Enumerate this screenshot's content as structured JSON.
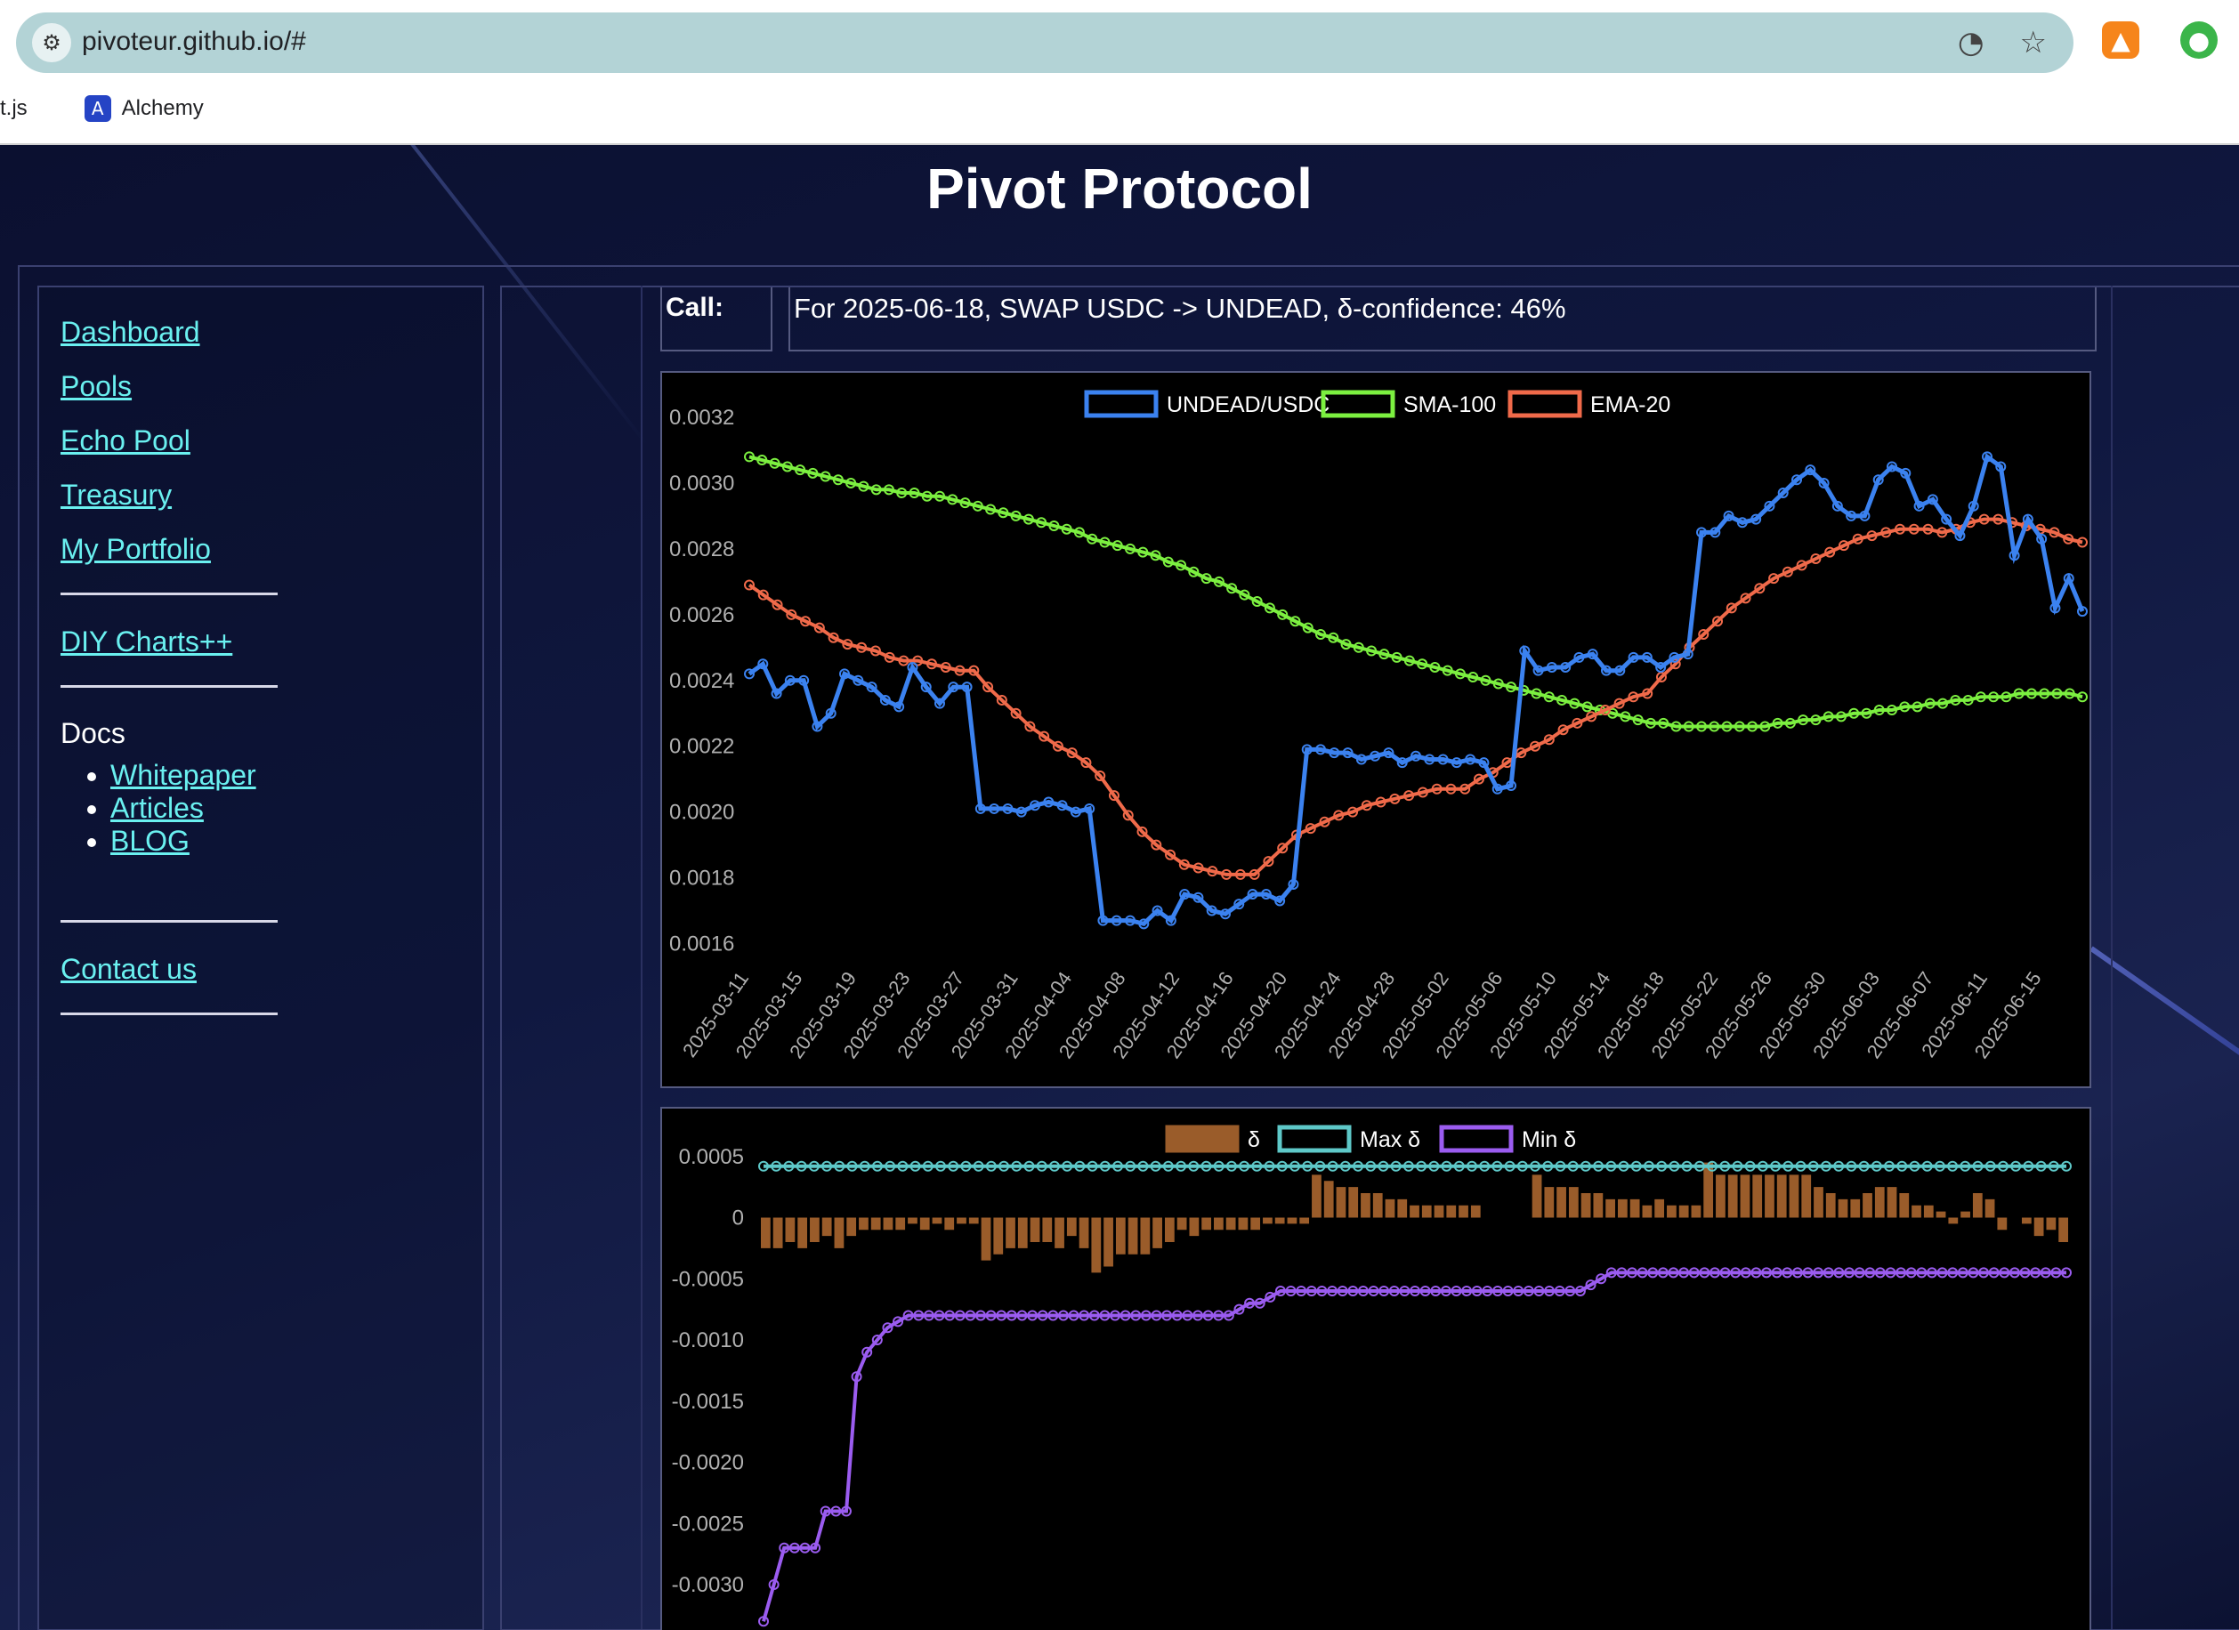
{
  "browser": {
    "url": "pivoteur.github.io/#",
    "bookmarks": [
      {
        "label": "t.js"
      },
      {
        "label": "Alchemy"
      }
    ]
  },
  "page": {
    "title": "Pivot Protocol"
  },
  "sidebar": {
    "nav": [
      "Dashboard",
      "Pools",
      "Echo Pool",
      "Treasury",
      "My Portfolio"
    ],
    "diy": "DIY Charts++",
    "docs_label": "Docs",
    "docs": [
      "Whitepaper",
      "Articles",
      "BLOG"
    ],
    "contact": "Contact us"
  },
  "call": {
    "label": "Call:",
    "text": "For 2025-06-18, SWAP USDC -> UNDEAD, δ-confidence: 46%"
  },
  "colors": {
    "price": "#3b82f0",
    "sma": "#7cf040",
    "ema": "#f06a4a",
    "delta": "#9a5c2a",
    "max_delta": "#5ec8c8",
    "min_delta": "#9b5cf0",
    "link": "#6af0f0"
  },
  "chart_data": [
    {
      "type": "line",
      "series": [
        {
          "name": "UNDEAD/USDC",
          "values": [
            0.00242,
            0.00245,
            0.00236,
            0.0024,
            0.0024,
            0.00226,
            0.0023,
            0.00242,
            0.0024,
            0.00238,
            0.00234,
            0.00232,
            0.00244,
            0.00238,
            0.00233,
            0.00238,
            0.00238,
            0.00201,
            0.00201,
            0.00201,
            0.002,
            0.00202,
            0.00203,
            0.00202,
            0.002,
            0.00201,
            0.00167,
            0.00167,
            0.00167,
            0.00166,
            0.0017,
            0.00167,
            0.00175,
            0.00174,
            0.0017,
            0.00169,
            0.00172,
            0.00175,
            0.00175,
            0.00173,
            0.00178,
            0.00219,
            0.00219,
            0.00218,
            0.00218,
            0.00216,
            0.00217,
            0.00218,
            0.00215,
            0.00217,
            0.00216,
            0.00216,
            0.00215,
            0.00216,
            0.00215,
            0.00207,
            0.00208,
            0.00249,
            0.00243,
            0.00244,
            0.00244,
            0.00247,
            0.00248,
            0.00243,
            0.00243,
            0.00247,
            0.00247,
            0.00244,
            0.00247,
            0.00248,
            0.00285,
            0.00285,
            0.0029,
            0.00288,
            0.00289,
            0.00293,
            0.00297,
            0.00301,
            0.00304,
            0.003,
            0.00293,
            0.0029,
            0.0029,
            0.00301,
            0.00305,
            0.00303,
            0.00293,
            0.00295,
            0.00289,
            0.00284,
            0.00293,
            0.00308,
            0.00305,
            0.00278,
            0.00289,
            0.00283,
            0.00262,
            0.00271,
            0.00261
          ],
          "markers": true
        },
        {
          "name": "SMA-100",
          "values": [
            0.00308,
            0.00307,
            0.00306,
            0.00305,
            0.00304,
            0.00303,
            0.00302,
            0.00301,
            0.003,
            0.00299,
            0.00298,
            0.00298,
            0.00297,
            0.00297,
            0.00296,
            0.00296,
            0.00295,
            0.00294,
            0.00293,
            0.00292,
            0.00291,
            0.0029,
            0.00289,
            0.00288,
            0.00287,
            0.00286,
            0.00285,
            0.00283,
            0.00282,
            0.00281,
            0.0028,
            0.00279,
            0.00278,
            0.00276,
            0.00275,
            0.00273,
            0.00271,
            0.0027,
            0.00268,
            0.00266,
            0.00264,
            0.00262,
            0.0026,
            0.00258,
            0.00256,
            0.00254,
            0.00253,
            0.00251,
            0.0025,
            0.00249,
            0.00248,
            0.00247,
            0.00246,
            0.00245,
            0.00244,
            0.00243,
            0.00242,
            0.00241,
            0.0024,
            0.00239,
            0.00238,
            0.00237,
            0.00236,
            0.00235,
            0.00234,
            0.00233,
            0.00232,
            0.00231,
            0.0023,
            0.00229,
            0.00228,
            0.00227,
            0.00227,
            0.00226,
            0.00226,
            0.00226,
            0.00226,
            0.00226,
            0.00226,
            0.00226,
            0.00226,
            0.00227,
            0.00227,
            0.00228,
            0.00228,
            0.00229,
            0.00229,
            0.0023,
            0.0023,
            0.00231,
            0.00231,
            0.00232,
            0.00232,
            0.00233,
            0.00233,
            0.00234,
            0.00234,
            0.00235,
            0.00235,
            0.00235,
            0.00236,
            0.00236,
            0.00236,
            0.00236,
            0.00236,
            0.00235
          ],
          "markers": true
        },
        {
          "name": "EMA-20",
          "values": [
            0.00269,
            0.00266,
            0.00263,
            0.0026,
            0.00258,
            0.00256,
            0.00253,
            0.00251,
            0.0025,
            0.00249,
            0.00247,
            0.00246,
            0.00246,
            0.00245,
            0.00244,
            0.00243,
            0.00243,
            0.00238,
            0.00234,
            0.0023,
            0.00226,
            0.00223,
            0.0022,
            0.00218,
            0.00215,
            0.00211,
            0.00205,
            0.00199,
            0.00194,
            0.0019,
            0.00187,
            0.00184,
            0.00183,
            0.00182,
            0.00181,
            0.00181,
            0.00181,
            0.00185,
            0.00189,
            0.00193,
            0.00195,
            0.00197,
            0.00199,
            0.002,
            0.00202,
            0.00203,
            0.00204,
            0.00205,
            0.00206,
            0.00207,
            0.00207,
            0.00207,
            0.0021,
            0.00212,
            0.00215,
            0.00218,
            0.0022,
            0.00222,
            0.00225,
            0.00227,
            0.00229,
            0.00231,
            0.00233,
            0.00235,
            0.00236,
            0.00241,
            0.00245,
            0.0025,
            0.00254,
            0.00258,
            0.00262,
            0.00265,
            0.00268,
            0.00271,
            0.00273,
            0.00275,
            0.00277,
            0.00279,
            0.00281,
            0.00283,
            0.00284,
            0.00285,
            0.00286,
            0.00286,
            0.00286,
            0.00285,
            0.00286,
            0.00288,
            0.00289,
            0.00289,
            0.00288,
            0.00287,
            0.00286,
            0.00285,
            0.00283,
            0.00282
          ],
          "markers": true
        }
      ],
      "x_range": [
        "2025-03-11",
        "2025-06-18"
      ],
      "x_tick_labels": [
        "2025-03-11",
        "2025-03-15",
        "2025-03-19",
        "2025-03-23",
        "2025-03-27",
        "2025-03-31",
        "2025-04-04",
        "2025-04-08",
        "2025-04-12",
        "2025-04-16",
        "2025-04-20",
        "2025-04-24",
        "2025-04-28",
        "2025-05-02",
        "2025-05-06",
        "2025-05-10",
        "2025-05-14",
        "2025-05-18",
        "2025-05-22",
        "2025-05-26",
        "2025-05-30",
        "2025-06-03",
        "2025-06-07",
        "2025-06-11",
        "2025-06-15"
      ],
      "y_tick_labels": [
        "0.0032",
        "0.0030",
        "0.0028",
        "0.0026",
        "0.0024",
        "0.0022",
        "0.0020",
        "0.0018",
        "0.0016"
      ],
      "ylim": [
        0.00155,
        0.0032
      ],
      "legend_position": "top-center",
      "grid": false
    },
    {
      "type": "bar",
      "series": [
        {
          "name": "δ",
          "kind": "bar",
          "values": [
            -0.00025,
            -0.00025,
            -0.0002,
            -0.00025,
            -0.0002,
            -0.00015,
            -0.00025,
            -0.00015,
            -0.0001,
            -0.0001,
            -0.0001,
            -0.0001,
            -5e-05,
            -0.0001,
            -5e-05,
            -0.0001,
            -5e-05,
            -5e-05,
            -0.00035,
            -0.0003,
            -0.00025,
            -0.00025,
            -0.0002,
            -0.0002,
            -0.00025,
            -0.00015,
            -0.00025,
            -0.00045,
            -0.0004,
            -0.0003,
            -0.0003,
            -0.0003,
            -0.00025,
            -0.0002,
            -0.0001,
            -0.00015,
            -0.0001,
            -0.0001,
            -0.0001,
            -0.0001,
            -0.0001,
            -5e-05,
            -5e-05,
            -5e-05,
            -5e-05,
            0.00035,
            0.0003,
            0.00025,
            0.00025,
            0.0002,
            0.0002,
            0.00015,
            0.00015,
            0.0001,
            0.0001,
            0.0001,
            0.0001,
            0.0001,
            0.0001,
            0.0,
            0.0,
            0.0,
            0.0,
            0.00035,
            0.00025,
            0.00025,
            0.00025,
            0.0002,
            0.0002,
            0.00015,
            0.00015,
            0.00015,
            0.0001,
            0.00015,
            0.0001,
            0.0001,
            0.0001,
            0.00045,
            0.00035,
            0.00035,
            0.00035,
            0.00035,
            0.00035,
            0.00035,
            0.00035,
            0.00035,
            0.00025,
            0.0002,
            0.00015,
            0.00015,
            0.0002,
            0.00025,
            0.00025,
            0.0002,
            0.0001,
            0.0001,
            5e-05,
            -5e-05,
            5e-05,
            0.0002,
            0.00015,
            -0.0001,
            0.0,
            -5e-05,
            -0.00015,
            -0.0001,
            -0.0002
          ]
        },
        {
          "name": "Max δ",
          "kind": "line",
          "value": 0.00042,
          "markers": true
        },
        {
          "name": "Min δ",
          "kind": "line",
          "markers": true,
          "values": [
            -0.0033,
            -0.003,
            -0.0027,
            -0.0027,
            -0.0027,
            -0.0027,
            -0.0024,
            -0.0024,
            -0.0024,
            -0.0013,
            -0.0011,
            -0.001,
            -0.0009,
            -0.00085,
            -0.0008,
            -0.0008,
            -0.0008,
            -0.0008,
            -0.0008,
            -0.0008,
            -0.0008,
            -0.0008,
            -0.0008,
            -0.0008,
            -0.0008,
            -0.0008,
            -0.0008,
            -0.0008,
            -0.0008,
            -0.0008,
            -0.0008,
            -0.0008,
            -0.0008,
            -0.0008,
            -0.0008,
            -0.0008,
            -0.0008,
            -0.0008,
            -0.0008,
            -0.0008,
            -0.0008,
            -0.0008,
            -0.0008,
            -0.0008,
            -0.0008,
            -0.0008,
            -0.00075,
            -0.0007,
            -0.0007,
            -0.00065,
            -0.0006,
            -0.0006,
            -0.0006,
            -0.0006,
            -0.0006,
            -0.0006,
            -0.0006,
            -0.0006,
            -0.0006,
            -0.0006,
            -0.0006,
            -0.0006,
            -0.0006,
            -0.0006,
            -0.0006,
            -0.0006,
            -0.0006,
            -0.0006,
            -0.0006,
            -0.0006,
            -0.0006,
            -0.0006,
            -0.0006,
            -0.0006,
            -0.0006,
            -0.0006,
            -0.0006,
            -0.0006,
            -0.0006,
            -0.0006,
            -0.00055,
            -0.0005,
            -0.00045,
            -0.00045,
            -0.00045,
            -0.00045,
            -0.00045,
            -0.00045,
            -0.00045,
            -0.00045,
            -0.00045,
            -0.00045,
            -0.00045,
            -0.00045,
            -0.00045,
            -0.00045,
            -0.00045,
            -0.00045,
            -0.00045,
            -0.00045,
            -0.00045,
            -0.00045,
            -0.00045,
            -0.00045,
            -0.00045,
            -0.00045,
            -0.00045,
            -0.00045,
            -0.00045,
            -0.00045,
            -0.00045,
            -0.00045,
            -0.00045,
            -0.00045,
            -0.00045,
            -0.00045,
            -0.00045,
            -0.00045,
            -0.00045,
            -0.00045,
            -0.00045,
            -0.00045,
            -0.00045,
            -0.00045,
            -0.00045,
            -0.00045,
            -0.00045
          ]
        }
      ],
      "y_tick_labels": [
        "0.0005",
        "0",
        "-0.0005",
        "-0.0010",
        "-0.0015",
        "-0.0020",
        "-0.0025",
        "-0.0030"
      ],
      "ylim": [
        -0.0034,
        0.0006
      ],
      "legend_position": "top-center",
      "grid": false
    }
  ]
}
